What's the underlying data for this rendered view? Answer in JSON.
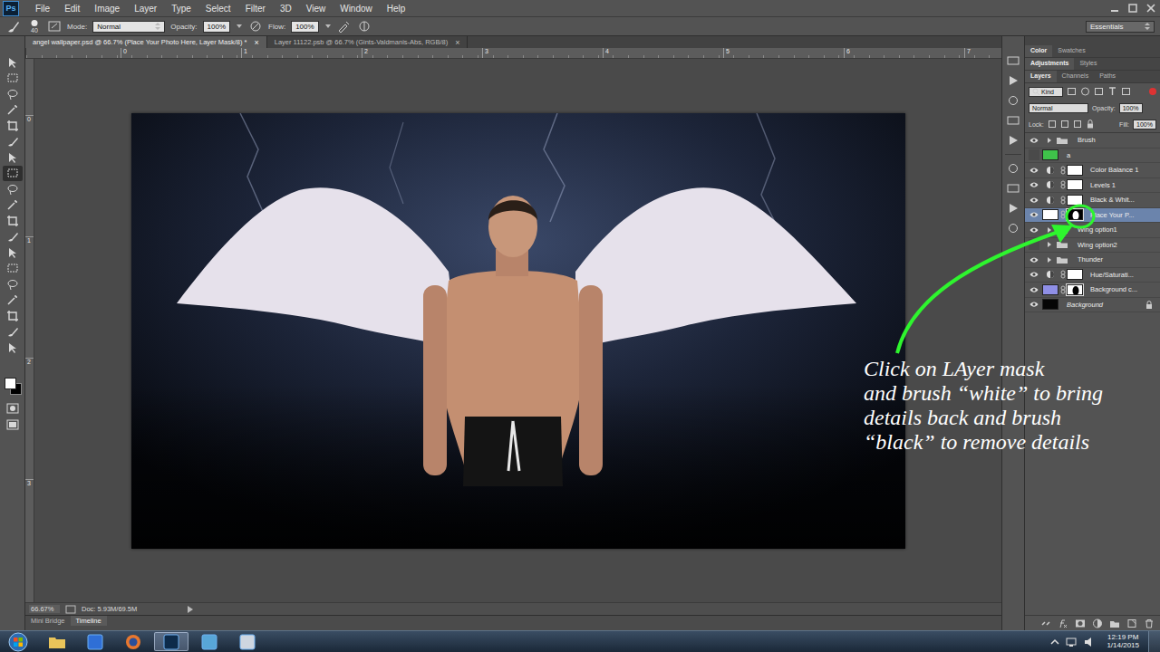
{
  "app": {
    "logo": "Ps"
  },
  "menu": [
    "File",
    "Edit",
    "Image",
    "Layer",
    "Type",
    "Select",
    "Filter",
    "3D",
    "View",
    "Window",
    "Help"
  ],
  "options_bar": {
    "brush_size": "40",
    "mode_label": "Mode:",
    "mode": "Normal",
    "opacity_label": "Opacity:",
    "opacity": "100%",
    "flow_label": "Flow:",
    "flow": "100%",
    "workspace": "Essentials"
  },
  "documents": [
    {
      "label": "angel wallpaper.psd @ 66.7% (Place Your Photo Here, Layer Mask/8) *",
      "close": "×",
      "selected": true
    },
    {
      "label": "Layer 11122.psb @ 66.7% (Gints-Valdmanis-Abs, RGB/8)",
      "close": "×",
      "selected": false
    }
  ],
  "tools": [
    {
      "selected": false
    },
    {
      "selected": false
    },
    {
      "selected": false
    },
    {
      "selected": false
    },
    {
      "selected": false
    },
    {
      "selected": false
    },
    {
      "selected": false
    },
    {
      "selected": true
    },
    {
      "selected": false
    },
    {
      "selected": false
    },
    {
      "selected": false
    },
    {
      "selected": false
    },
    {
      "selected": false
    },
    {
      "selected": false
    },
    {
      "selected": false
    },
    {
      "selected": false
    },
    {
      "selected": false
    },
    {
      "selected": false
    },
    {
      "selected": false
    }
  ],
  "ruler_top": [
    "0",
    "1",
    "2",
    "3",
    "4",
    "5",
    "6",
    "7"
  ],
  "ruler_left": [
    "0",
    "1",
    "2",
    "3"
  ],
  "status_bar": {
    "zoom": "66.67%",
    "doc": "Doc: 5.93M/69.5M"
  },
  "bottom_tabs": [
    {
      "label": "Mini Bridge",
      "selected": false
    },
    {
      "label": "Timeline",
      "selected": true
    }
  ],
  "panels": {
    "color_tabs": [
      {
        "label": "Color",
        "selected": true
      },
      {
        "label": "Swatches",
        "selected": false
      }
    ],
    "adjustment_tabs": [
      {
        "label": "Adjustments",
        "selected": true
      },
      {
        "label": "Styles",
        "selected": false
      }
    ],
    "layer_tabs": [
      {
        "label": "Layers",
        "selected": true
      },
      {
        "label": "Channels",
        "selected": false
      },
      {
        "label": "Paths",
        "selected": false
      }
    ],
    "filter": "Kind",
    "blend": "Normal",
    "opacity_label": "Opacity:",
    "opacity": "100%",
    "lock_label": "Lock:",
    "fill_label": "Fill:",
    "fill": "100%"
  },
  "layers": [
    {
      "name": "Brush",
      "kind": "group",
      "visible": true,
      "selected": false,
      "expanded": false,
      "locked": false,
      "color": "#6b6b6b",
      "mask_color": "#000000"
    },
    {
      "name": "a",
      "kind": "pixel",
      "visible": false,
      "selected": false,
      "expanded": false,
      "locked": false,
      "color": "#3fc24a",
      "mask_color": "#000000"
    },
    {
      "name": "Color Balance 1",
      "kind": "adjustment",
      "visible": true,
      "selected": false,
      "expanded": false,
      "locked": false,
      "color": "#ffffff",
      "mask_color": "#000000"
    },
    {
      "name": "Levels 1",
      "kind": "adjustment",
      "visible": true,
      "selected": false,
      "expanded": false,
      "locked": false,
      "color": "#ffffff",
      "mask_color": "#000000"
    },
    {
      "name": "Black & Whit...",
      "kind": "adjustment",
      "visible": true,
      "selected": false,
      "expanded": false,
      "locked": false,
      "color": "#ffffff",
      "mask_color": "#000000"
    },
    {
      "name": "Place Your P...",
      "kind": "masked",
      "visible": true,
      "selected": true,
      "expanded": false,
      "locked": false,
      "color": "#ffffff",
      "mask_color": "#000000"
    },
    {
      "name": "Wing option1",
      "kind": "group",
      "visible": true,
      "selected": false,
      "expanded": false,
      "locked": false,
      "color": "#6b6b6b",
      "mask_color": "#000000"
    },
    {
      "name": "Wing option2",
      "kind": "group",
      "visible": false,
      "selected": false,
      "expanded": false,
      "locked": false,
      "color": "#6b6b6b",
      "mask_color": "#000000"
    },
    {
      "name": "Thunder",
      "kind": "group",
      "visible": true,
      "selected": false,
      "expanded": false,
      "locked": false,
      "color": "#6b6b6b",
      "mask_color": "#000000"
    },
    {
      "name": "Hue/Saturati...",
      "kind": "adjustment",
      "visible": true,
      "selected": false,
      "expanded": false,
      "locked": false,
      "color": "#ffffff",
      "mask_color": "#000000"
    },
    {
      "name": "Background c...",
      "kind": "masked",
      "visible": true,
      "selected": false,
      "expanded": false,
      "locked": false,
      "color": "#8f8fe6",
      "mask_color": "#ffffff"
    },
    {
      "name": "Background",
      "kind": "background",
      "visible": true,
      "selected": false,
      "expanded": false,
      "locked": true,
      "color": "#050505",
      "mask_color": "#000000"
    }
  ],
  "annotation": {
    "lines": [
      "Click on LAyer mask",
      "and brush “white” to bring",
      "details back and brush",
      "“black” to remove details"
    ]
  },
  "taskbar": {
    "apps": [
      {
        "selected": false
      },
      {
        "selected": false
      },
      {
        "selected": false
      },
      {
        "selected": true
      },
      {
        "selected": false
      },
      {
        "selected": false
      }
    ],
    "time": "12:19 PM",
    "date": "1/14/2015"
  }
}
